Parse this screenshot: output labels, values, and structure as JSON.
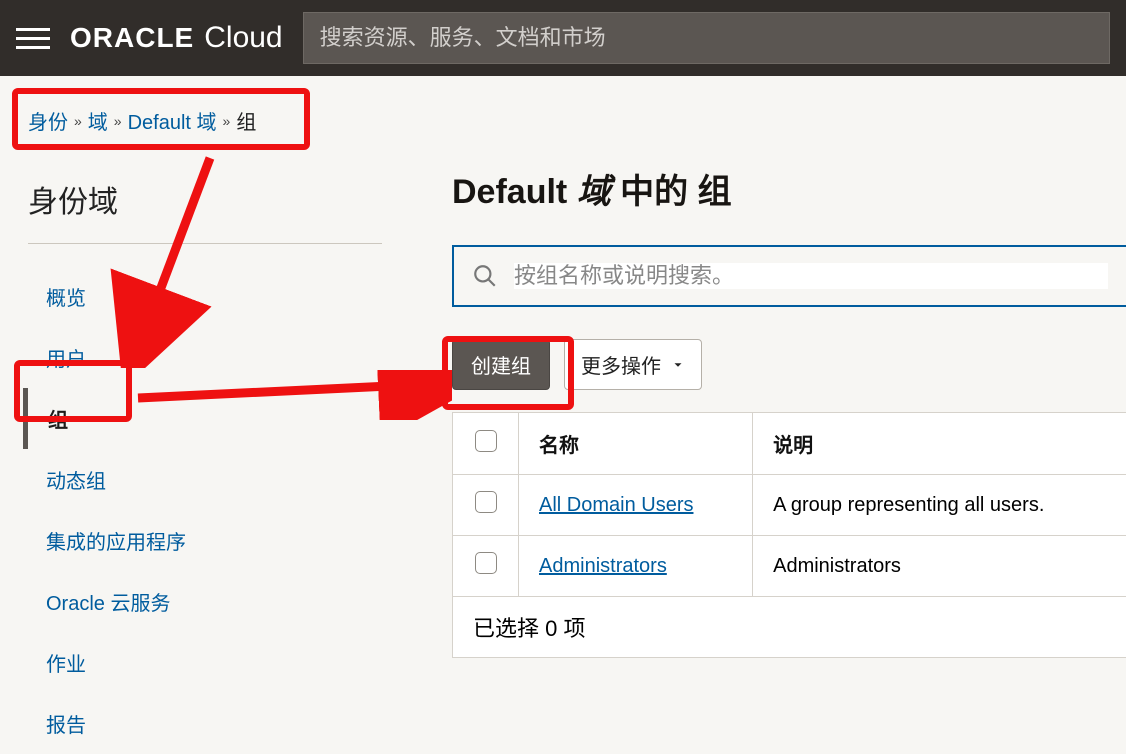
{
  "header": {
    "brand_bold": "ORACLE",
    "brand_light": "Cloud",
    "search_placeholder": "搜索资源、服务、文档和市场"
  },
  "breadcrumbs": [
    {
      "label": "身份",
      "link": true
    },
    {
      "label": "域",
      "link": true
    },
    {
      "label": "Default 域",
      "link": true
    },
    {
      "label": "组",
      "link": false
    }
  ],
  "sidebar": {
    "heading": "身份域",
    "items": [
      {
        "label": "概览",
        "active": false
      },
      {
        "label": "用户",
        "active": false
      },
      {
        "label": "组",
        "active": true
      },
      {
        "label": "动态组",
        "active": false
      },
      {
        "label": "集成的应用程序",
        "active": false
      },
      {
        "label": "Oracle 云服务",
        "active": false
      },
      {
        "label": "作业",
        "active": false
      },
      {
        "label": "报告",
        "active": false
      }
    ]
  },
  "main": {
    "title_prefix": "Default",
    "title_italic": "域",
    "title_suffix": "中的 组",
    "filter_placeholder": "按组名称或说明搜索。",
    "create_button": "创建组",
    "more_actions": "更多操作",
    "table": {
      "col_name": "名称",
      "col_desc": "说明",
      "rows": [
        {
          "name": "All Domain Users",
          "desc": "A group representing all users."
        },
        {
          "name": "Administrators",
          "desc": "Administrators"
        }
      ]
    },
    "selection_text": "已选择 0 项"
  }
}
